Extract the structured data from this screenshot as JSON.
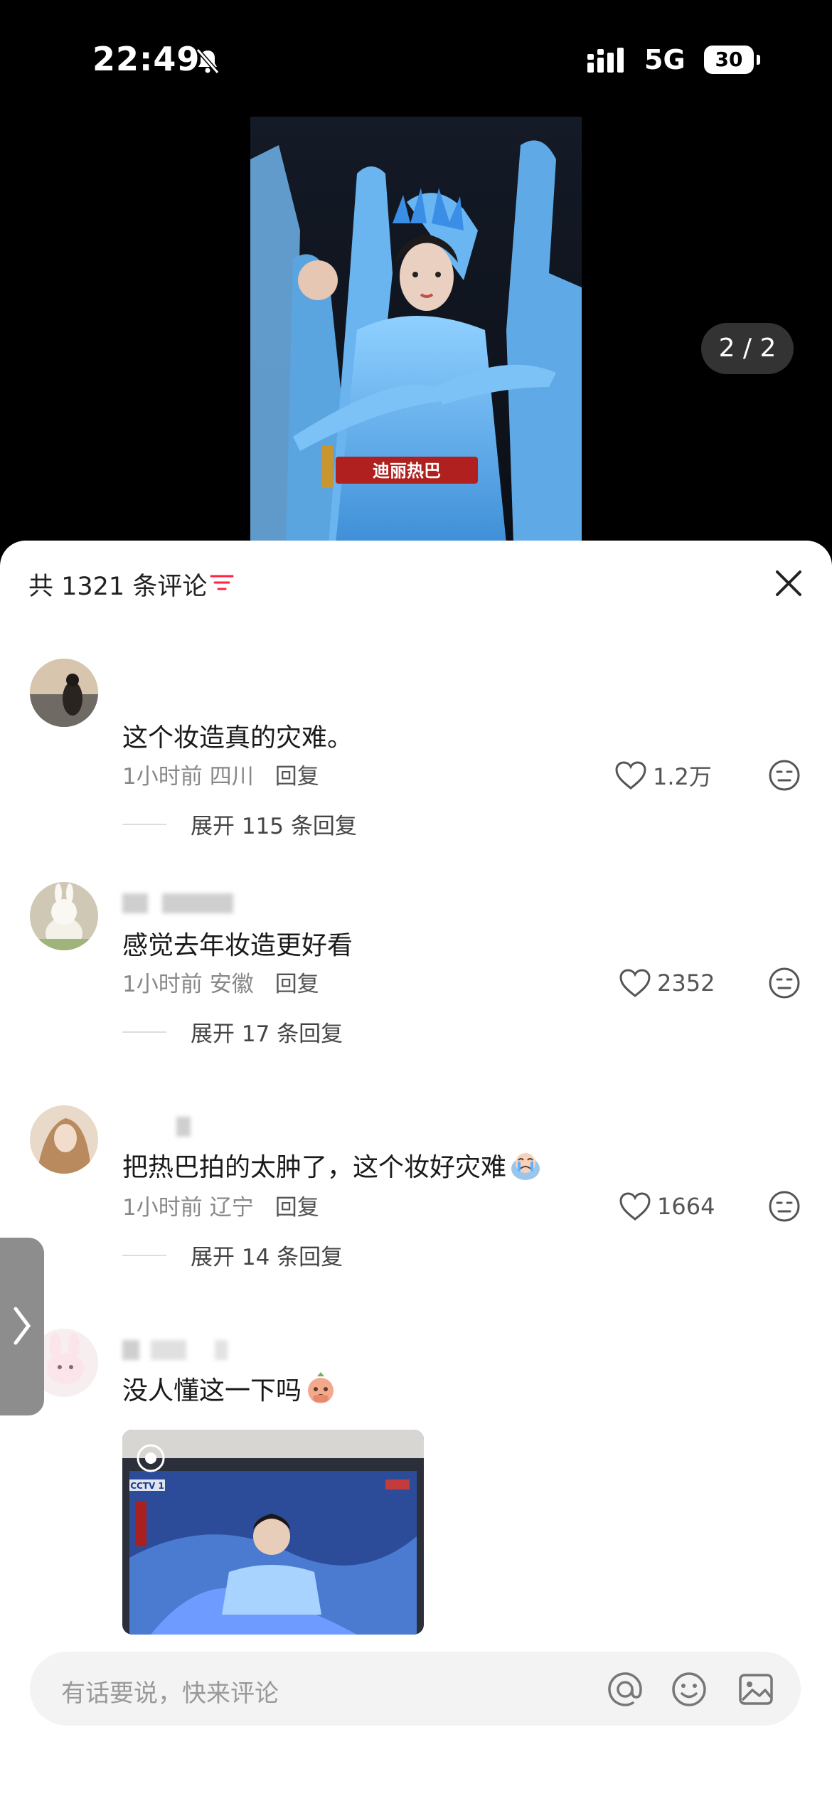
{
  "status_bar": {
    "time": "22:49",
    "network": "5G",
    "battery": "30",
    "icons": [
      "bell-slash-icon",
      "signal-bars-icon"
    ]
  },
  "media": {
    "page_indicator": "2 / 2",
    "caption": "迪丽热巴"
  },
  "sheet": {
    "comment_count": "共 1321 条评论",
    "accent_color": "#ff2442"
  },
  "comments": [
    {
      "text": "这个妆造真的灾难。",
      "time": "1小时前",
      "location": "四川",
      "reply_label": "回复",
      "likes": "1.2万",
      "expand_label": "展开 115 条回复"
    },
    {
      "text": "感觉去年妆造更好看",
      "time": "1小时前",
      "location": "安徽",
      "reply_label": "回复",
      "likes": "2352",
      "expand_label": "展开 17 条回复"
    },
    {
      "text": "把热巴拍的太肿了，这个妆好灾难",
      "time": "1小时前",
      "location": "辽宁",
      "reply_label": "回复",
      "likes": "1664",
      "expand_label": "展开 14 条回复"
    },
    {
      "text": "没人懂这一下吗"
    }
  ],
  "comment_image": {
    "channel_logo": "CCTV 1"
  },
  "input_bar": {
    "placeholder": "有话要说，快来评论"
  }
}
